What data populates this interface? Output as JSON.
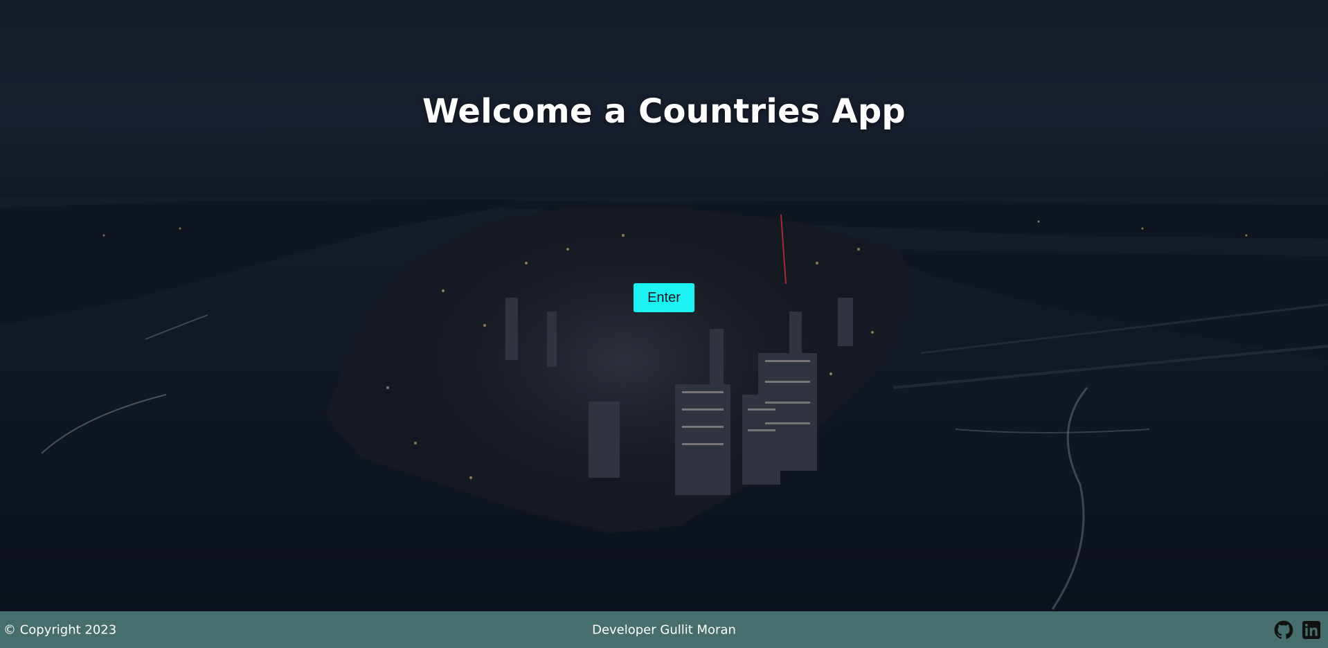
{
  "hero": {
    "title": "Welcome a Countries App",
    "enter_label": "Enter"
  },
  "footer": {
    "copyright": "© Copyright 2023",
    "developer": "Developer Gullit Moran",
    "icons": [
      "github-icon",
      "linkedin-icon"
    ]
  },
  "colors": {
    "accent": "#1cf2f2",
    "footer_bg": "#466e6c",
    "sky": "#1b2331",
    "water": "#0f1622"
  }
}
